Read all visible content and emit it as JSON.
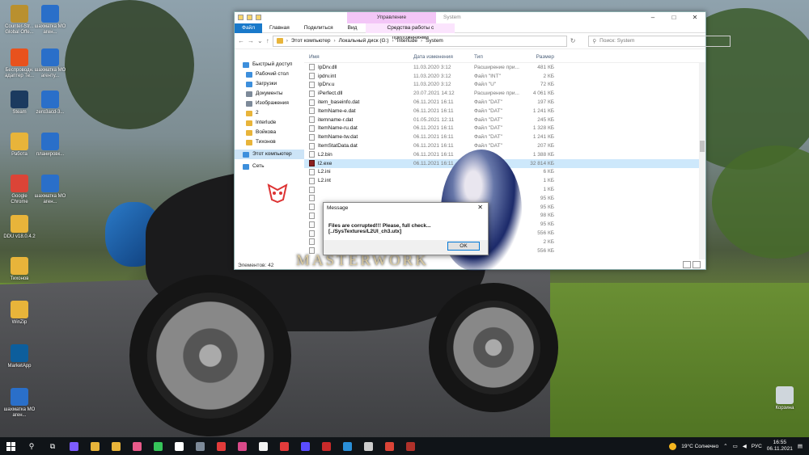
{
  "desktop": {
    "icons": [
      {
        "label": "Counter-Str... Global Offe...",
        "color": "#b9902f"
      },
      {
        "label": "шахматка МО аген...",
        "color": "#2a6fc9"
      },
      {
        "label": "Беспроводн. адаптер Те...",
        "color": "#e8521d"
      },
      {
        "label": "шахматка МО агенту...",
        "color": "#2a6fc9"
      },
      {
        "label": "Steam",
        "color": "#1b3a5f"
      },
      {
        "label": "zero3acd-3...",
        "color": "#2a6fc9"
      },
      {
        "label": "Работа",
        "color": "#e8b43a"
      },
      {
        "label": "планировк...",
        "color": "#2a6fc9"
      },
      {
        "label": "Google Chrome",
        "color": "#db4437"
      },
      {
        "label": "шахматка МО аген...",
        "color": "#2a6fc9"
      },
      {
        "label": "DDU v18.0.4.2",
        "color": "#e8b43a"
      },
      {
        "label": "Тихонов",
        "color": "#e8b43a"
      },
      {
        "label": "WinZip",
        "color": "#e8b43a"
      },
      {
        "label": "MarketApp",
        "color": "#0d5e9c"
      },
      {
        "label": "шахматка МО аген...",
        "color": "#2a6fc9"
      },
      {
        "label": "Корзина",
        "color": "#cfd6dc"
      }
    ]
  },
  "explorer": {
    "title": "System",
    "ribbon_ctx_label": "Управление",
    "tabs": [
      "Файл",
      "Главная",
      "Поделиться",
      "Вид"
    ],
    "tab_ctx": "Средства работы с приложениями",
    "breadcrumb": [
      "Этот компьютер",
      "Локальный диск (G:)",
      "Interlude",
      "System"
    ],
    "search_placeholder": "Поиск: System",
    "nav": [
      {
        "label": "Быстрый доступ",
        "color": "#3d8fdc",
        "level": 0
      },
      {
        "label": "Рабочий стол",
        "color": "#3d8fdc",
        "level": 1
      },
      {
        "label": "Загрузки",
        "color": "#3d8fdc",
        "level": 1
      },
      {
        "label": "Документы",
        "color": "#7d8a99",
        "level": 1
      },
      {
        "label": "Изображения",
        "color": "#7d8a99",
        "level": 1
      },
      {
        "label": "2",
        "color": "#e8b43a",
        "level": 1
      },
      {
        "label": "Interlude",
        "color": "#e8b43a",
        "level": 1
      },
      {
        "label": "Войкова",
        "color": "#e8b43a",
        "level": 1
      },
      {
        "label": "Тихонов",
        "color": "#e8b43a",
        "level": 1
      },
      {
        "label": "Этот компьютер",
        "color": "#3d8fdc",
        "level": 0,
        "selected": true
      },
      {
        "label": "Сеть",
        "color": "#3d8fdc",
        "level": 0
      }
    ],
    "columns": {
      "name": "Имя",
      "date": "Дата изменения",
      "type": "Тип",
      "size": "Размер"
    },
    "files": [
      {
        "name": "IpDrv.dll",
        "date": "11.03.2020 3:12",
        "type": "Расширение при...",
        "size": "481 КБ"
      },
      {
        "name": "ipdrv.int",
        "date": "11.03.2020 3:12",
        "type": "Файл \"INT\"",
        "size": "2 КБ"
      },
      {
        "name": "IpDrv.u",
        "date": "11.03.2020 3:12",
        "type": "Файл \"U\"",
        "size": "72 КБ"
      },
      {
        "name": "iPerfect.dll",
        "date": "20.07.2021 14:12",
        "type": "Расширение при...",
        "size": "4 061 КБ"
      },
      {
        "name": "item_baseinfo.dat",
        "date": "06.11.2021 16:11",
        "type": "Файл \"DAT\"",
        "size": "197 КБ"
      },
      {
        "name": "ItemName-e.dat",
        "date": "06.11.2021 16:11",
        "type": "Файл \"DAT\"",
        "size": "1 241 КБ"
      },
      {
        "name": "itemname-r.dat",
        "date": "01.05.2021 12:11",
        "type": "Файл \"DAT\"",
        "size": "245 КБ"
      },
      {
        "name": "ItemName-ru.dat",
        "date": "06.11.2021 16:11",
        "type": "Файл \"DAT\"",
        "size": "1 328 КБ"
      },
      {
        "name": "ItemName-tw.dat",
        "date": "06.11.2021 16:11",
        "type": "Файл \"DAT\"",
        "size": "1 241 КБ"
      },
      {
        "name": "ItemStatData.dat",
        "date": "06.11.2021 16:11",
        "type": "Файл \"DAT\"",
        "size": "207 КБ"
      },
      {
        "name": "L2.bin",
        "date": "06.11.2021 16:11",
        "type": "",
        "size": "1 388 КБ"
      },
      {
        "name": "l2.exe",
        "date": "06.11.2021 16:11",
        "type": "",
        "size": "32 814 КБ",
        "highlight": true
      },
      {
        "name": "L2.ini",
        "date": "",
        "type": "",
        "size": "6 КБ"
      },
      {
        "name": "L2.int",
        "date": "",
        "type": "",
        "size": "1 КБ"
      },
      {
        "name": "",
        "date": "",
        "type": "",
        "size": "1 КБ"
      },
      {
        "name": "",
        "date": "",
        "type": "",
        "size": "95 КБ"
      },
      {
        "name": "",
        "date": "",
        "type": "",
        "size": "95 КБ"
      },
      {
        "name": "",
        "date": "",
        "type": "",
        "size": "98 КБ"
      },
      {
        "name": "",
        "date": "",
        "type": "",
        "size": "95 КБ"
      },
      {
        "name": "",
        "date": "",
        "type": "",
        "size": "556 КБ"
      },
      {
        "name": "",
        "date": "",
        "type": "",
        "size": "2 КБ"
      },
      {
        "name": "",
        "date": "",
        "type": "",
        "size": "556 КБ"
      }
    ],
    "status": "Элементов: 42"
  },
  "splash": {
    "text": "MASTERWORK"
  },
  "dialog": {
    "title": "Message",
    "message": "Files are corrupted!!! Please, full check... [../SysTextures/L2UI_ch3.utx]",
    "ok_label": "OK"
  },
  "taskbar": {
    "apps": [
      "#7d5cff",
      "#e8b43a",
      "#e8b43a",
      "#e85a8a",
      "#36c45a",
      "#ffffff",
      "#7d8a99",
      "#e23b3b",
      "#d94a8a",
      "#f2f2f2",
      "#e23b3b",
      "#5a4cff",
      "#c82a2a",
      "#2a8fd8",
      "#cccccc",
      "#db4437",
      "#b0312a"
    ],
    "weather": "19°C  Солнечно",
    "lang": "РУС",
    "time": "16:55",
    "date": "06.11.2021"
  }
}
